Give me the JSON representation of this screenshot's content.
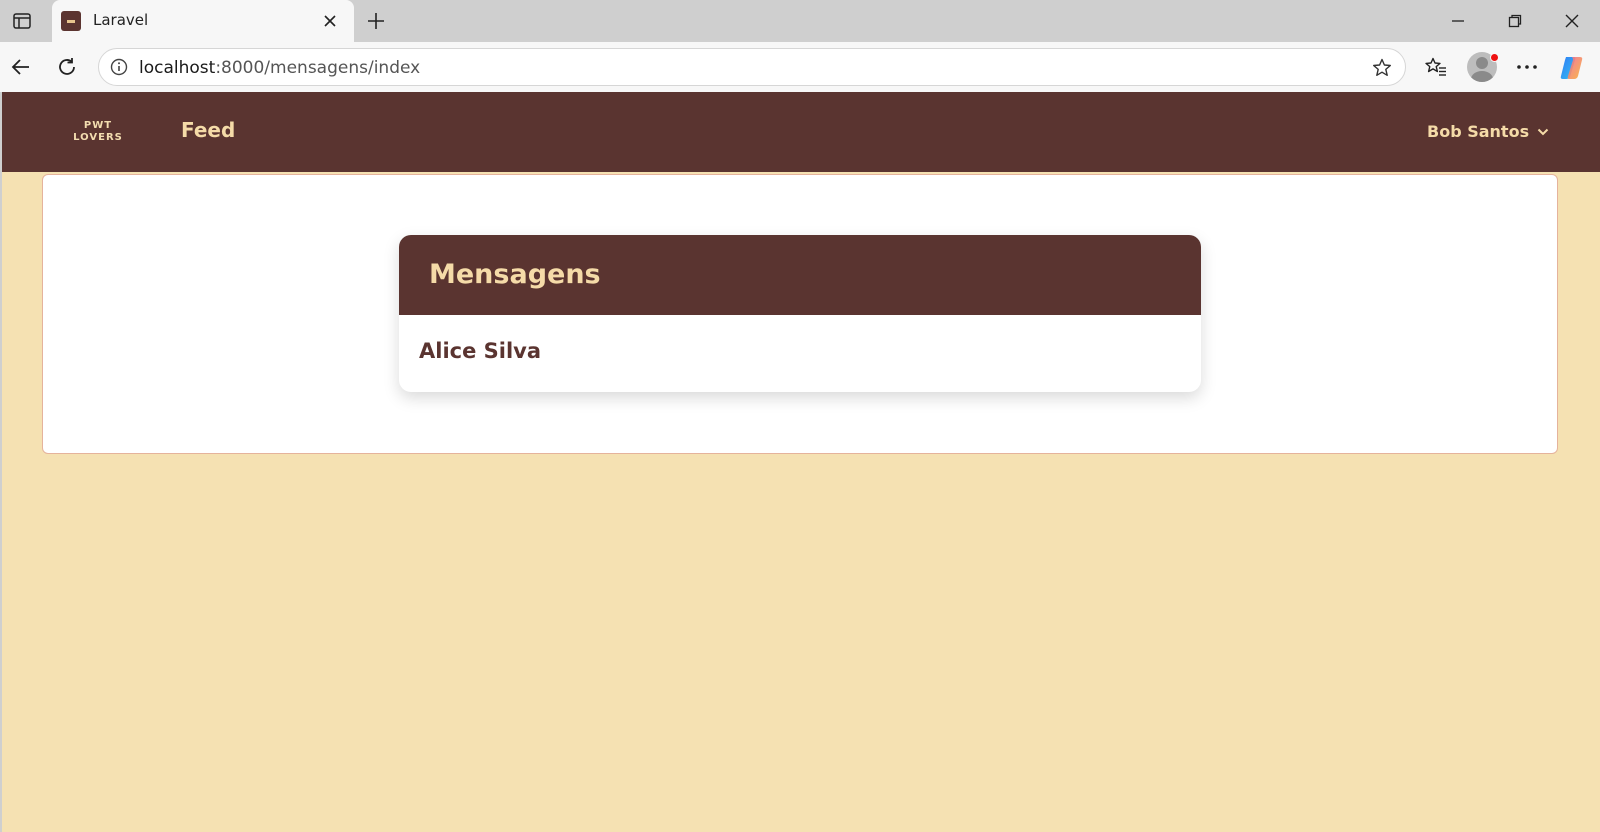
{
  "browser": {
    "tab_title": "Laravel",
    "url_host": "localhost",
    "url_path": ":8000/mensagens/index"
  },
  "navbar": {
    "logo_line1": "PWT",
    "logo_line2": "LOVERS",
    "feed_label": "Feed",
    "user_name": "Bob Santos"
  },
  "messages": {
    "title": "Mensagens",
    "contacts": [
      {
        "name": "Alice Silva"
      }
    ]
  },
  "colors": {
    "brand_brown": "#5a3430",
    "brand_cream": "#f5dba8",
    "page_background": "#f5e1b2"
  }
}
